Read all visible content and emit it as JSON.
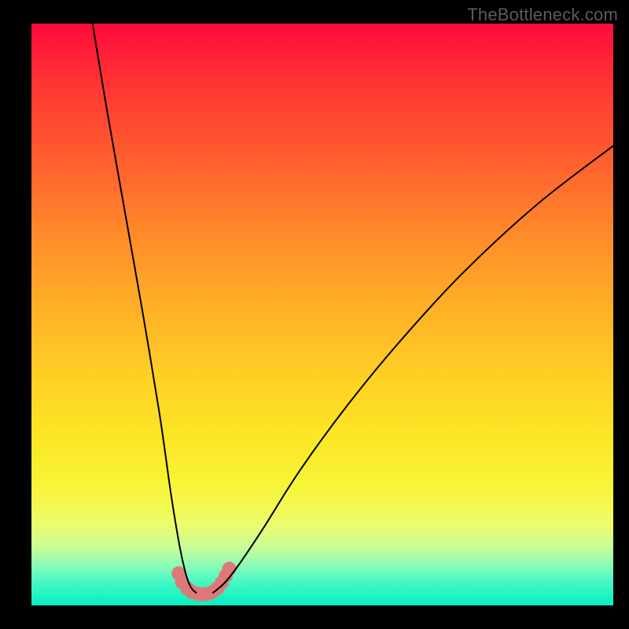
{
  "watermark": "TheBottleneck.com",
  "chart_data": {
    "type": "line",
    "title": "",
    "xlabel": "",
    "ylabel": "",
    "xlim": [
      0,
      100
    ],
    "ylim": [
      0,
      100
    ],
    "grid": false,
    "series": [
      {
        "name": "left-branch",
        "x": [
          10.5,
          13,
          16,
          19,
          22,
          24,
          25.5,
          26.5,
          27.2,
          27.8,
          28.3
        ],
        "y": [
          100,
          85,
          68,
          51,
          33,
          19,
          10,
          5.5,
          3.5,
          2.6,
          2.2
        ],
        "stroke": "#000000",
        "width": 2
      },
      {
        "name": "right-branch",
        "x": [
          31.2,
          32,
          33.5,
          36,
          40,
          46,
          54,
          63,
          74,
          87,
          100
        ],
        "y": [
          2.2,
          2.8,
          4.2,
          7.5,
          13.5,
          23,
          34,
          45,
          57,
          69,
          79
        ],
        "stroke": "#000000",
        "width": 2
      },
      {
        "name": "bottom-u",
        "x": [
          25.3,
          25.9,
          26.8,
          27.6,
          28.5,
          29.4,
          30.3,
          31.1,
          31.9,
          32.7,
          33.4,
          34.0
        ],
        "y": [
          5.5,
          4.0,
          2.9,
          2.3,
          2.0,
          1.9,
          2.0,
          2.3,
          2.9,
          3.9,
          5.1,
          6.3
        ],
        "stroke": "#dd7a78",
        "width": 11,
        "markers": true,
        "marker_r": 9
      }
    ],
    "gradient_stops": [
      {
        "pos": 0.0,
        "color": "#ff0a3a"
      },
      {
        "pos": 0.1,
        "color": "#ff3434"
      },
      {
        "pos": 0.22,
        "color": "#ff5a2f"
      },
      {
        "pos": 0.36,
        "color": "#ff8a2a"
      },
      {
        "pos": 0.5,
        "color": "#ffb326"
      },
      {
        "pos": 0.62,
        "color": "#ffd324"
      },
      {
        "pos": 0.72,
        "color": "#fbe826"
      },
      {
        "pos": 0.8,
        "color": "#f7f63a"
      },
      {
        "pos": 0.86,
        "color": "#eefc6e"
      },
      {
        "pos": 0.9,
        "color": "#c8fd96"
      },
      {
        "pos": 0.93,
        "color": "#8efcb6"
      },
      {
        "pos": 0.96,
        "color": "#45f8c4"
      },
      {
        "pos": 1.0,
        "color": "#06efc1"
      }
    ]
  }
}
